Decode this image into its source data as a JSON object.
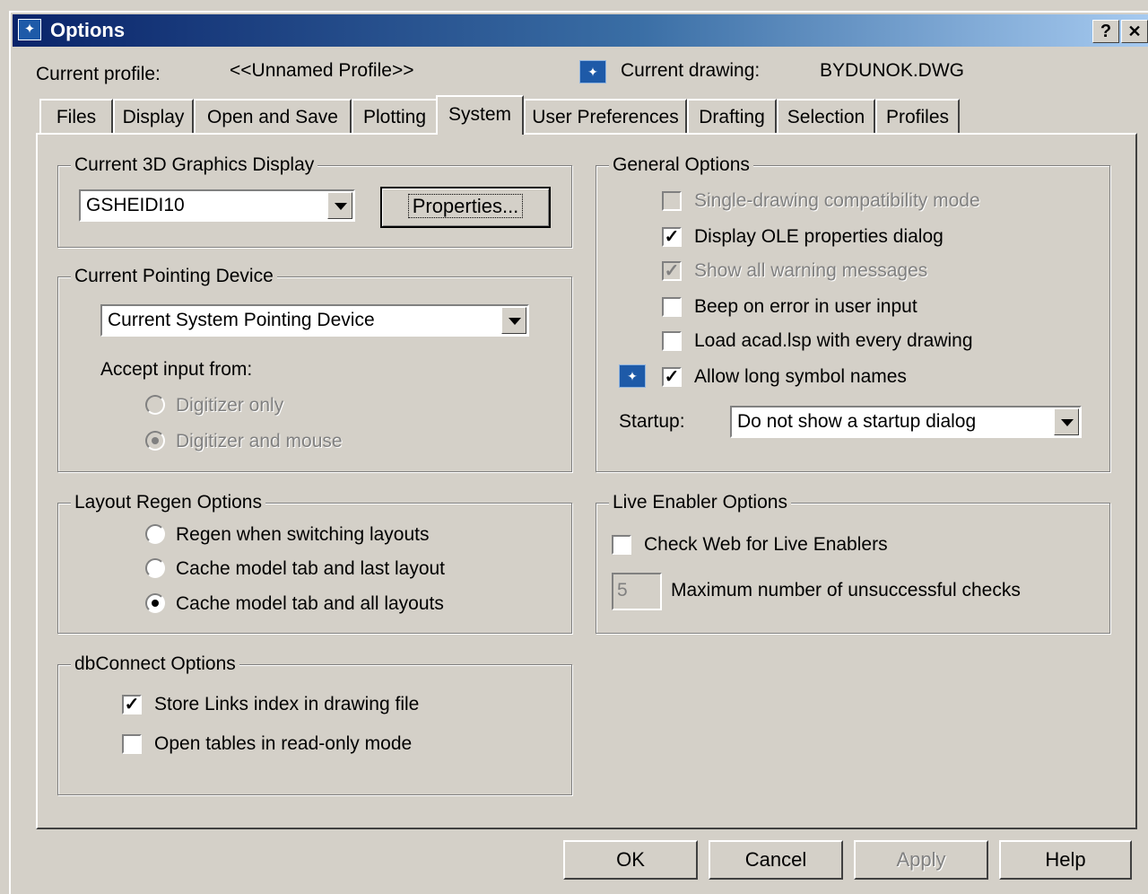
{
  "window": {
    "title": "Options",
    "help_btn": "?",
    "close_btn": "✕"
  },
  "header": {
    "profile_label": "Current profile:",
    "profile_value": "<<Unnamed Profile>>",
    "drawing_label": "Current drawing:",
    "drawing_value": "BYDUNOK.DWG"
  },
  "tabs": [
    "Files",
    "Display",
    "Open and Save",
    "Plotting",
    "System",
    "User Preferences",
    "Drafting",
    "Selection",
    "Profiles"
  ],
  "graphics": {
    "legend": "Current 3D Graphics Display",
    "combo_value": "GSHEIDI10",
    "properties_btn": "Properties..."
  },
  "pointing": {
    "legend": "Current Pointing Device",
    "combo_value": "Current System Pointing Device",
    "accept_label": "Accept input from:",
    "option1": "Digitizer only",
    "option2": "Digitizer and mouse"
  },
  "layout_regen": {
    "legend": "Layout Regen Options",
    "option1": "Regen when switching layouts",
    "option2": "Cache model tab and last layout",
    "option3": "Cache model tab and all layouts"
  },
  "dbconnect": {
    "legend": "dbConnect Options",
    "store_links": "Store Links index in drawing file",
    "open_tables": "Open tables in read-only mode"
  },
  "general": {
    "legend": "General Options",
    "single_drawing": "Single-drawing compatibility mode",
    "display_ole": "Display OLE properties dialog",
    "show_warnings": "Show all warning messages",
    "beep_error": "Beep on error in user input",
    "load_acad": "Load acad.lsp with every drawing",
    "long_symbol": "Allow long symbol names",
    "startup_label": "Startup:",
    "startup_value": "Do not show a startup dialog"
  },
  "live_enabler": {
    "legend": "Live Enabler Options",
    "check_web": "Check Web for Live Enablers",
    "max_value": "5",
    "max_label": "Maximum number of unsuccessful checks"
  },
  "buttons": {
    "ok": "OK",
    "cancel": "Cancel",
    "apply": "Apply",
    "help": "Help"
  },
  "icons": {
    "title": "options-icon",
    "drawing": "drawing-icon",
    "symbol": "drawing-icon"
  }
}
